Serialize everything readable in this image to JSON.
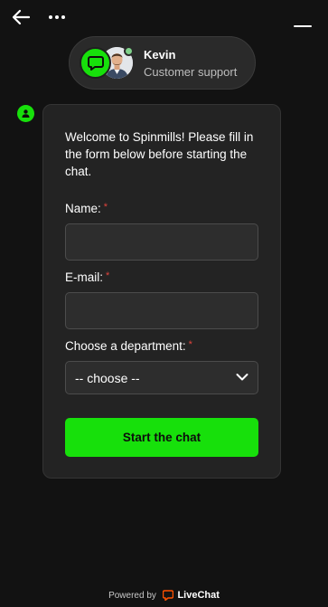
{
  "header": {
    "back_icon": "arrow-left-icon",
    "more_icon": "more-horizontal-icon",
    "minimize_icon": "minimize-icon"
  },
  "agent": {
    "name": "Kevin",
    "role": "Customer support",
    "status_color": "#7fd18a",
    "brand_color": "#17e00b"
  },
  "form": {
    "welcome": "Welcome to Spinmills! Please fill in the form below before starting the chat.",
    "name_label": "Name:",
    "name_value": "",
    "email_label": "E-mail:",
    "email_value": "",
    "department_label": "Choose a department:",
    "department_value": "-- choose --",
    "required_mark": "*",
    "submit_label": "Start the chat"
  },
  "footer": {
    "powered_by": "Powered by",
    "brand": "LiveChat"
  }
}
